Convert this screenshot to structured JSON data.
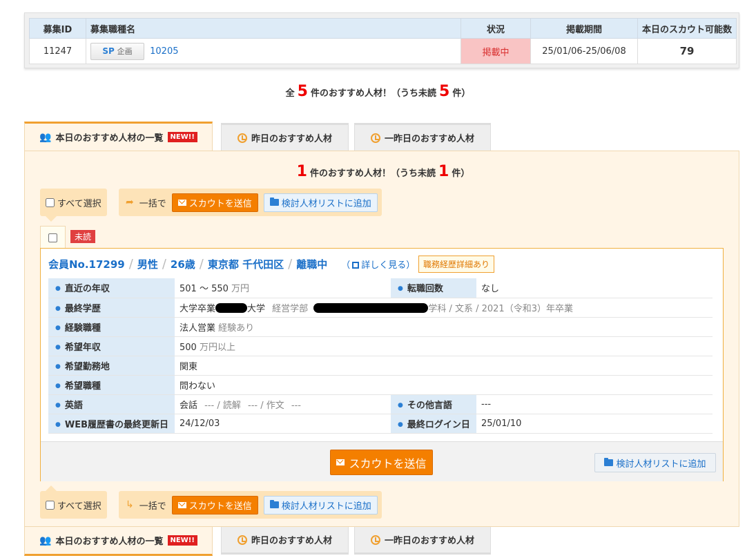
{
  "job": {
    "headers": [
      "募集ID",
      "募集職種名",
      "状況",
      "掲載期間",
      "本日のスカウト可能数"
    ],
    "id": "11247",
    "sp_label": "SP",
    "sp_sub": "企画",
    "title_link": "10205",
    "status": "掲載中",
    "period": "25/01/06-25/06/08",
    "scout_count": "79"
  },
  "totals": {
    "prefix": "全",
    "total": "5",
    "middle": "件のおすすめ人材！（うち未読",
    "unread": "5",
    "suffix": "件）"
  },
  "tabs": {
    "today": "本日のおすすめ人材の一覧",
    "new_badge": "NEW!!",
    "yesterday": "昨日のおすすめ人材",
    "day_before": "一昨日のおすすめ人材"
  },
  "panel_count": {
    "total": "1",
    "middle": "件のおすすめ人材！（うち未読",
    "unread": "1",
    "suffix": "件）"
  },
  "actions": {
    "select_all": "すべて選択",
    "bulk": "一括で",
    "send_scout": "スカウトを送信",
    "add_list": "検討人材リストに追加"
  },
  "candidate": {
    "unread_label": "未読",
    "member_no": "会員No.17299",
    "gender": "男性",
    "age": "26歳",
    "location": "東京都 千代田区",
    "job_status": "離職中",
    "detail_open": "（",
    "detail_link": "詳しく見る",
    "detail_close": "）",
    "career_tag": "職務経歴詳細あり",
    "rows": {
      "recent_income_label": "直近の年収",
      "recent_income_value": "501 ～ 550",
      "recent_income_unit": "万円",
      "job_changes_label": "転職回数",
      "job_changes_value": "なし",
      "education_label": "最終学歴",
      "education_a": "大学卒業",
      "education_b": "大学",
      "education_c": "経営学部",
      "education_d": "学科 / 文系 / 2021（令和3）年卒業",
      "experience_label": "経験職種",
      "experience_value": "法人営業",
      "experience_note": "経験あり",
      "desired_income_label": "希望年収",
      "desired_income_value": "500",
      "desired_income_unit": "万円以上",
      "desired_location_label": "希望勤務地",
      "desired_location_value": "関東",
      "desired_job_label": "希望職種",
      "desired_job_value": "問わない",
      "english_label": "英語",
      "english_value_a": "会話",
      "english_value_b": "--- / 読解",
      "english_value_c": "--- / 作文",
      "english_value_d": "---",
      "other_lang_label": "その他言語",
      "other_lang_value": "---",
      "resume_update_label": "WEB履歴書の最終更新日",
      "resume_update_value": "24/12/03",
      "last_login_label": "最終ログイン日",
      "last_login_value": "25/01/10"
    }
  },
  "colors": {
    "accent_orange": "#f47f00",
    "link_blue": "#1a6fc8",
    "alert_red": "#e00000",
    "panel_bg": "#fff5e6"
  }
}
